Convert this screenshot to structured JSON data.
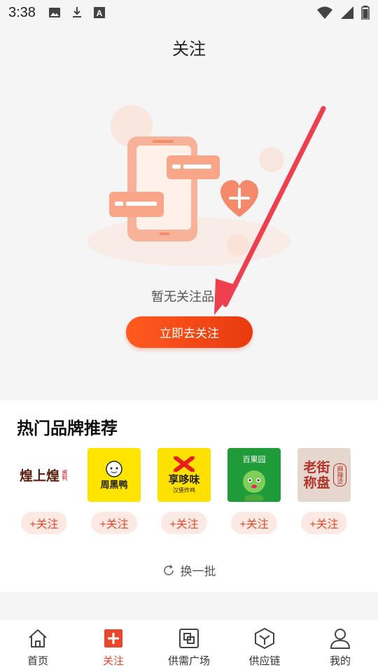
{
  "status_bar": {
    "time": "3:38",
    "icons": [
      "image-icon",
      "download-icon",
      "a-icon",
      "wifi-icon",
      "signal-icon",
      "battery-icon"
    ]
  },
  "header": {
    "title": "关注"
  },
  "empty_state": {
    "message": "暂无关注品牌",
    "button_label": "立即去关注"
  },
  "hot_brands": {
    "title": "热门品牌推荐",
    "brands": [
      {
        "name": "煌上煌",
        "sub": "酱鸭",
        "follow_label": "+关注"
      },
      {
        "name": "周黑鸭",
        "follow_label": "+关注"
      },
      {
        "name": "享哆味",
        "sub": "汉堡炸鸡",
        "follow_label": "+关注"
      },
      {
        "name": "百果园",
        "follow_label": "+关注"
      },
      {
        "name": "老街称盘",
        "sub": "麻辣烫",
        "follow_label": "+关注"
      }
    ],
    "refresh_label": "换一批"
  },
  "nav": {
    "items": [
      {
        "label": "首页",
        "icon": "home-icon"
      },
      {
        "label": "关注",
        "icon": "plus-square-icon",
        "active": true
      },
      {
        "label": "供需广场",
        "icon": "square-icon"
      },
      {
        "label": "供应链",
        "icon": "hexagon-icon"
      },
      {
        "label": "我的",
        "icon": "user-icon"
      }
    ]
  },
  "colors": {
    "accent": "#e8472b",
    "button_start": "#ff5a1f",
    "button_end": "#e83a0e"
  }
}
